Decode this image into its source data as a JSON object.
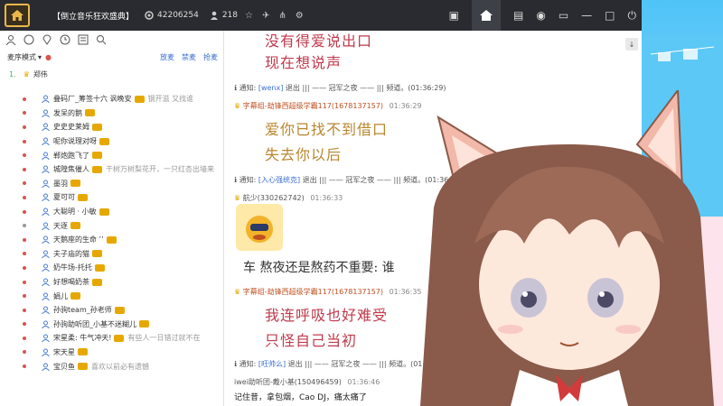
{
  "titlebar": {
    "room_title": "【倒立音乐狂欢盛典】",
    "room_id": "42206254",
    "online_count": "218"
  },
  "left": {
    "mode_label": "麦序模式",
    "links": [
      "放麦",
      "禁麦",
      "抢麦"
    ],
    "mic_index": "1.",
    "mic_user": "郑伟",
    "users": [
      {
        "name": "叠码厂_筹签十六 讽晚安",
        "note": "钢开滋 又找谁",
        "dot": "red"
      },
      {
        "name": "发呆的鹅",
        "note": "",
        "dot": "red"
      },
      {
        "name": "史史史莱姆",
        "note": "",
        "dot": "red"
      },
      {
        "name": "呢你说理对呀",
        "note": "",
        "dot": "red"
      },
      {
        "name": "郸炮跑飞了",
        "note": "",
        "dot": "red"
      },
      {
        "name": "城隍焦催人",
        "note": "干树万树梨花开，一只红杏出墙来",
        "dot": "red"
      },
      {
        "name": "墨羽",
        "note": "",
        "dot": "red"
      },
      {
        "name": "夏可可",
        "note": "",
        "dot": "red"
      },
      {
        "name": "大聪明 · 小敏",
        "note": "",
        "dot": "red"
      },
      {
        "name": "天逐",
        "note": "",
        "dot": "grey"
      },
      {
        "name": "天鹅座的生命 ’’",
        "note": "",
        "dot": "red"
      },
      {
        "name": "夫子庙的猫",
        "note": "",
        "dot": "red"
      },
      {
        "name": "奶牛场-托托",
        "note": "",
        "dot": "red"
      },
      {
        "name": "好想喝奶茶",
        "note": "",
        "dot": "red"
      },
      {
        "name": "娟儿",
        "note": "",
        "dot": "red"
      },
      {
        "name": "孙驹team_孙老师",
        "note": "",
        "dot": "red"
      },
      {
        "name": "孙驹助听团_小基不迷糊儿",
        "note": "",
        "dot": "red"
      },
      {
        "name": "宋星柔: 牛气冲天!",
        "note": "有些人一日错过就不在",
        "dot": "red"
      },
      {
        "name": "宋天星",
        "note": "",
        "dot": "red"
      },
      {
        "name": "宝贝鱼",
        "note": "喜欢以前必有遗憾",
        "dot": "red"
      }
    ]
  },
  "chat": {
    "art1_line1": "没有得爱说出口",
    "art1_line2": "现在想说声",
    "notice1": {
      "prefix": "通知:",
      "tag": "[wenx]",
      "body": "退出 ||| ——  冠军之夜  —— ||| 频道。(01:36:29)"
    },
    "sender1": {
      "name": "字幕组-劫锋西超级学霸117(1678137157)",
      "time": "01:36:29"
    },
    "art2_line1": "爱你已找不到借口",
    "art2_line2": "失去你以后",
    "notice2": {
      "prefix": "通知:",
      "tag": "[入心强统克]",
      "body": "退出 ||| ——  冠军之夜  —— ||| 频道。(01:36:33)"
    },
    "sender2": {
      "name": "航少(330262742)",
      "time": "01:36:33"
    },
    "big_text": "车  熬夜还是熬药不重要:  谁",
    "sender3": {
      "name": "字幕组-劫锋西超级学霸117(1678137157)",
      "time": "01:36:35"
    },
    "art3_line1": "我连呼吸也好难受",
    "art3_line2": "只怪自己当初",
    "notice3": {
      "prefix": "通知:",
      "tag": "[旺帅么]",
      "body": "退出 ||| ——  冠军之夜  —— ||| 频道。(01:36:45)"
    },
    "sender4": {
      "name": "iwei助听团-戴小基(150496459)",
      "time": "01:36:46"
    },
    "last_msg": "记住昔，拿包烟，Cao DJ，痛太痛了"
  },
  "colors": {
    "titlebar": "#2a2b30",
    "accent_link": "#3b6fd0",
    "art_red": "#c0394b",
    "art_gold": "#b8862e"
  }
}
